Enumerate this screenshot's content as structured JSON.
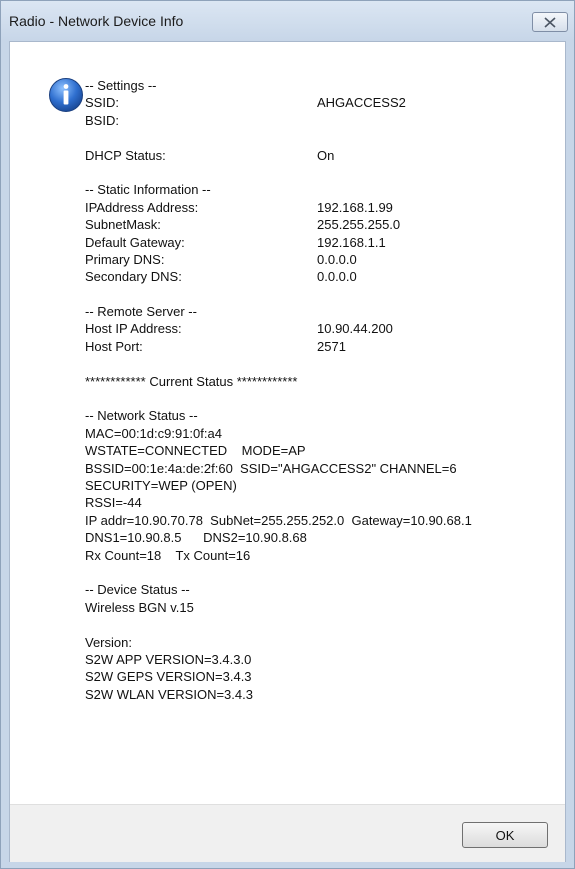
{
  "window": {
    "title": "Radio - Network Device Info"
  },
  "icons": {
    "close": "close-icon",
    "info": "info-icon"
  },
  "message": {
    "settings_header": "-- Settings --",
    "ssid_label": "SSID:",
    "ssid_value": "AHGACCESS2",
    "bsid_label": "BSID:",
    "bsid_value": "",
    "dhcp_label": "DHCP Status:",
    "dhcp_value": "On",
    "static_header": "-- Static Information --",
    "ip_label": "IPAddress Address:",
    "ip_value": "192.168.1.99",
    "mask_label": "SubnetMask:",
    "mask_value": "255.255.255.0",
    "gateway_label": "Default Gateway:",
    "gateway_value": "192.168.1.1",
    "dns1_label": "Primary DNS:",
    "dns1_value": "0.0.0.0",
    "dns2_label": "Secondary DNS:",
    "dns2_value": "0.0.0.0",
    "remote_header": "-- Remote Server --",
    "host_ip_label": "Host IP Address:",
    "host_ip_value": "10.90.44.200",
    "host_port_label": "Host Port:",
    "host_port_value": "2571",
    "current_status_banner": "************ Current Status ************",
    "network_header": "-- Network Status --",
    "network_lines": [
      "MAC=00:1d:c9:91:0f:a4",
      "WSTATE=CONNECTED    MODE=AP",
      "BSSID=00:1e:4a:de:2f:60  SSID=\"AHGACCESS2\" CHANNEL=6",
      "SECURITY=WEP (OPEN)",
      "RSSI=-44",
      "IP addr=10.90.70.78  SubNet=255.255.252.0  Gateway=10.90.68.1",
      "DNS1=10.90.8.5      DNS2=10.90.8.68",
      "Rx Count=18    Tx Count=16"
    ],
    "device_header": "-- Device Status --",
    "device_line": "Wireless BGN v.15",
    "version_header": "Version:",
    "version_lines": [
      "S2W APP VERSION=3.4.3.0",
      "S2W GEPS VERSION=3.4.3",
      "S2W WLAN VERSION=3.4.3"
    ]
  },
  "buttons": {
    "ok_label": "OK"
  },
  "colors": {
    "info_icon": "#2f6fcf",
    "titlebar": "#c7d6e8"
  }
}
